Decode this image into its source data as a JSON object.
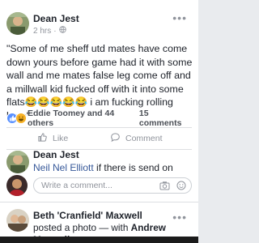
{
  "post": {
    "author": "Dean Jest",
    "time": "2 hrs",
    "text": "\"Some of me sheff utd mates have come down yours before game had it with some wall and me mates false leg come off and a millwall kid fucked off with it into some flats",
    "emojis": "😂😂😂😂😂",
    "text_end": " i am fucking rolling here\"",
    "reactions": {
      "names": "Eddie Toomey and 44 others",
      "comments": "15 comments",
      "icons": [
        "like-icon",
        "haha-icon"
      ]
    },
    "actions": {
      "like": "Like",
      "comment": "Comment"
    }
  },
  "comment": {
    "author": "Dean Jest",
    "tag": "Neil Nel Elliott",
    "text": " if there is send on"
  },
  "composer": {
    "placeholder": "Write a comment..."
  },
  "next_post": {
    "author": "Beth 'Cranfield' Maxwell",
    "action": "posted a photo — with",
    "tagged": "Andrew Maxwell"
  },
  "colors": {
    "link": "#365899",
    "muted": "#90949c",
    "like_blue": "#5890ff",
    "haha_yellow": "#f7b125"
  }
}
